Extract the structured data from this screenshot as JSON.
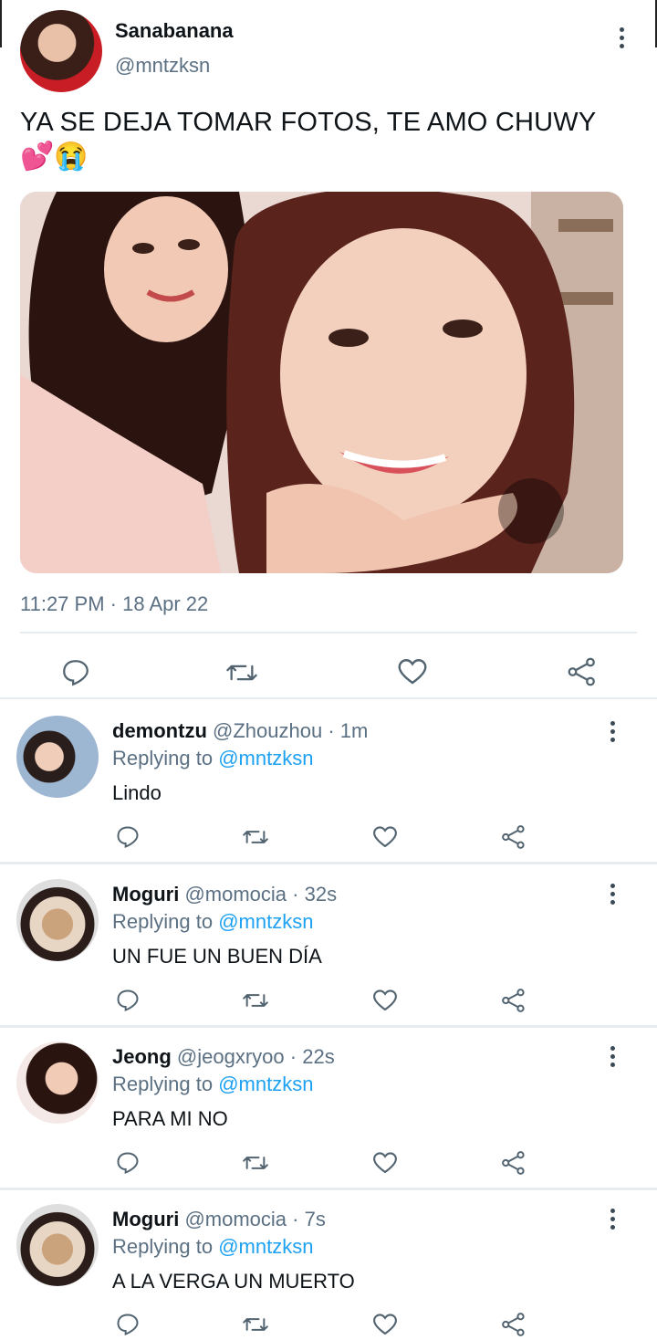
{
  "tweet": {
    "author_name": "Sanabanana",
    "author_handle": "@mntzksn",
    "text": "YA SE DEJA TOMAR FOTOS, TE AMO CHUWY",
    "emojis": "💕😭",
    "timestamp": "11:27 PM · 18 Apr 22",
    "photo_icon": "photo-two-people"
  },
  "replies": [
    {
      "name": "demontzu",
      "handle": "@Zhouzhou",
      "time": "· 1m",
      "replying_label": "Replying to",
      "replying_handle": "@mntzksn",
      "text": "Lindo"
    },
    {
      "name": "Moguri",
      "handle": "@momocia",
      "time": "· 32s",
      "replying_label": "Replying to",
      "replying_handle": "@mntzksn",
      "text": "UN FUE UN BUEN DÍA"
    },
    {
      "name": "Jeong",
      "handle": "@jeogxryoo",
      "time": "· 22s",
      "replying_label": "Replying to",
      "replying_handle": "@mntzksn",
      "text": "PARA MI NO"
    },
    {
      "name": "Moguri",
      "handle": "@momocia",
      "time": "· 7s",
      "replying_label": "Replying to",
      "replying_handle": "@mntzksn",
      "text": "A LA VERGA UN MUERTO"
    }
  ],
  "icons": [
    "reply-icon",
    "retweet-icon",
    "like-icon",
    "share-icon",
    "more-icon"
  ],
  "colors": {
    "link": "#1da1f2",
    "secondary": "#5b7083",
    "icon": "#536471",
    "divider": "#e6ecf0"
  }
}
